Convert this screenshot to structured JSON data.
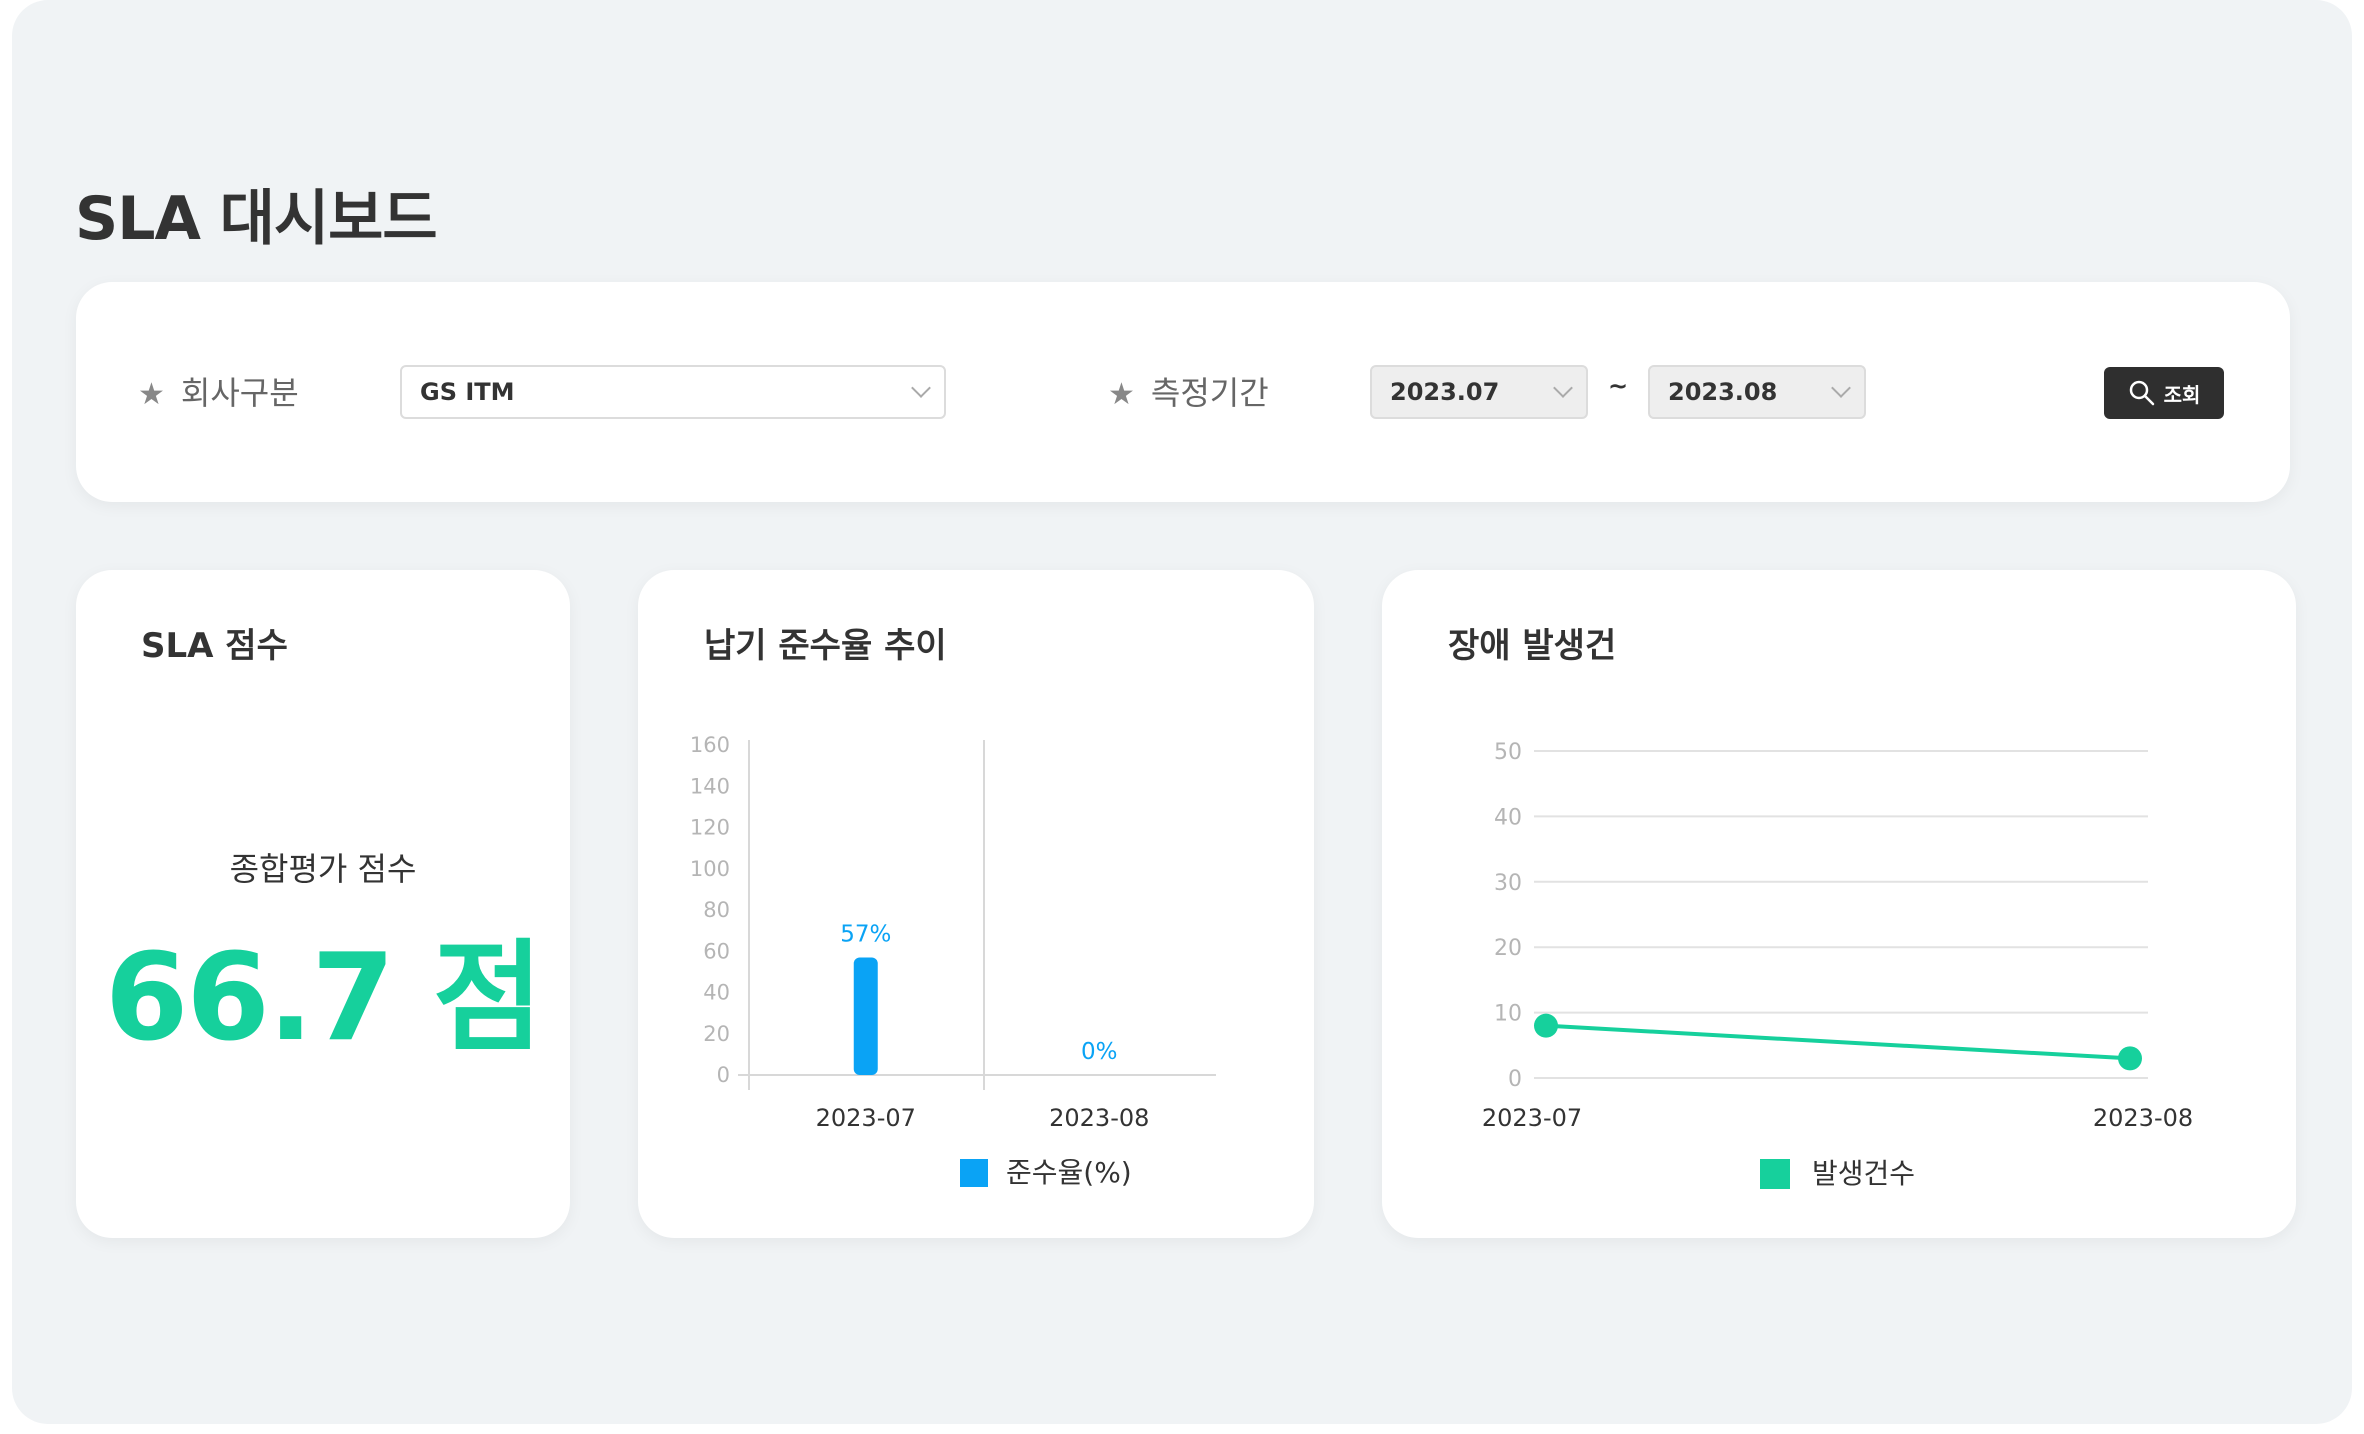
{
  "page": {
    "title": "SLA 대시보드"
  },
  "filters": {
    "company_label": "회사구분",
    "company_value": "GS ITM",
    "period_label": "측정기간",
    "period_start": "2023.07",
    "period_separator": "~",
    "period_end": "2023.08",
    "search_label": "조회"
  },
  "score_card": {
    "title": "SLA 점수",
    "label": "종합평가 점수",
    "value": "66.7 점"
  },
  "compliance_card": {
    "title": "납기 준수율 추이"
  },
  "incident_card": {
    "title": "장애 발생건"
  },
  "chart_data": [
    {
      "type": "bar",
      "title": "납기 준수율 추이",
      "categories": [
        "2023-07",
        "2023-08"
      ],
      "series": [
        {
          "name": "준수율(%)",
          "values": [
            57,
            0
          ],
          "color": "#0aa3f5"
        }
      ],
      "data_labels": [
        "57%",
        "0%"
      ],
      "ylim": [
        0,
        160
      ],
      "yticks": [
        0,
        20,
        40,
        60,
        80,
        100,
        120,
        140,
        160
      ],
      "grid": false,
      "legend": "bottom"
    },
    {
      "type": "line",
      "title": "장애 발생건",
      "categories": [
        "2023-07",
        "2023-08"
      ],
      "series": [
        {
          "name": "발생건수",
          "values": [
            8,
            3
          ],
          "color": "#16d09c"
        }
      ],
      "ylim": [
        0,
        50
      ],
      "yticks": [
        0,
        10,
        20,
        30,
        40,
        50
      ],
      "grid": true,
      "legend": "bottom"
    }
  ],
  "colors": {
    "accent_green": "#16d09c",
    "accent_blue": "#0aa3f5",
    "button_dark": "#2f2f2f"
  },
  "icons": {
    "required": "star-icon",
    "search": "search-icon",
    "dropdown": "chevron-down-icon"
  }
}
